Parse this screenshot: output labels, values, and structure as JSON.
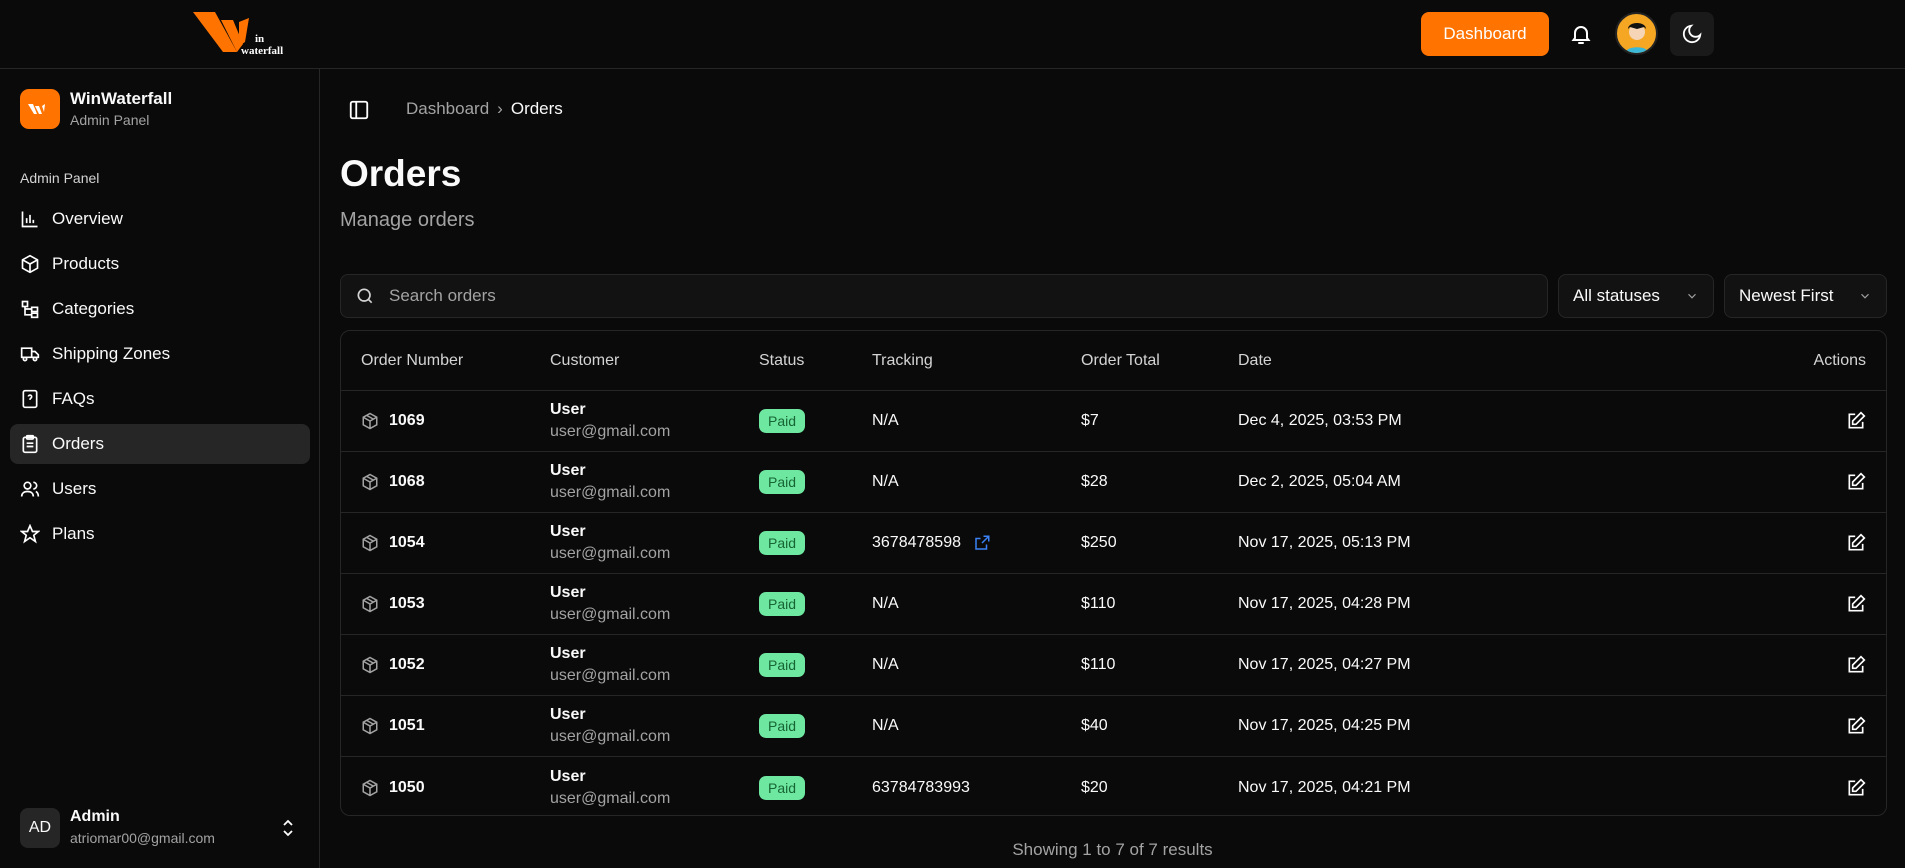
{
  "topbar": {
    "logo_text": "Win waterfall",
    "dashboard_button": "Dashboard"
  },
  "sidebar": {
    "brand_title": "WinWaterfall",
    "brand_subtitle": "Admin Panel",
    "section_label": "Admin Panel",
    "items": [
      {
        "label": "Overview",
        "icon": "chart-icon"
      },
      {
        "label": "Products",
        "icon": "box-icon"
      },
      {
        "label": "Categories",
        "icon": "tree-icon"
      },
      {
        "label": "Shipping Zones",
        "icon": "truck-icon"
      },
      {
        "label": "FAQs",
        "icon": "question-icon"
      },
      {
        "label": "Orders",
        "icon": "clipboard-icon",
        "active": true
      },
      {
        "label": "Users",
        "icon": "users-icon"
      },
      {
        "label": "Plans",
        "icon": "star-icon"
      }
    ],
    "user": {
      "initials": "AD",
      "name": "Admin",
      "email": "atriomar00@gmail.com"
    }
  },
  "breadcrumb": {
    "parent": "Dashboard",
    "current": "Orders"
  },
  "page": {
    "title": "Orders",
    "subtitle": "Manage orders"
  },
  "filters": {
    "search_placeholder": "Search orders",
    "status": "All statuses",
    "sort": "Newest First"
  },
  "table": {
    "headers": [
      "Order Number",
      "Customer",
      "Status",
      "Tracking",
      "Order Total",
      "Date",
      "Actions"
    ],
    "rows": [
      {
        "number": "1069",
        "name": "User",
        "email": "user@gmail.com",
        "status": "Paid",
        "tracking": "N/A",
        "link": false,
        "total": "$7",
        "date": "Dec 4, 2025, 03:53 PM"
      },
      {
        "number": "1068",
        "name": "User",
        "email": "user@gmail.com",
        "status": "Paid",
        "tracking": "N/A",
        "link": false,
        "total": "$28",
        "date": "Dec 2, 2025, 05:04 AM"
      },
      {
        "number": "1054",
        "name": "User",
        "email": "user@gmail.com",
        "status": "Paid",
        "tracking": "3678478598",
        "link": true,
        "total": "$250",
        "date": "Nov 17, 2025, 05:13 PM"
      },
      {
        "number": "1053",
        "name": "User",
        "email": "user@gmail.com",
        "status": "Paid",
        "tracking": "N/A",
        "link": false,
        "total": "$110",
        "date": "Nov 17, 2025, 04:28 PM"
      },
      {
        "number": "1052",
        "name": "User",
        "email": "user@gmail.com",
        "status": "Paid",
        "tracking": "N/A",
        "link": false,
        "total": "$110",
        "date": "Nov 17, 2025, 04:27 PM"
      },
      {
        "number": "1051",
        "name": "User",
        "email": "user@gmail.com",
        "status": "Paid",
        "tracking": "N/A",
        "link": false,
        "total": "$40",
        "date": "Nov 17, 2025, 04:25 PM"
      },
      {
        "number": "1050",
        "name": "User",
        "email": "user@gmail.com",
        "status": "Paid",
        "tracking": "63784783993",
        "link": false,
        "total": "$20",
        "date": "Nov 17, 2025, 04:21 PM"
      }
    ]
  },
  "results_text": "Showing 1 to 7 of 7 results",
  "colors": {
    "accent": "#ff7300",
    "paid_badge": "#6ee7a0",
    "link": "#3b82f6"
  }
}
